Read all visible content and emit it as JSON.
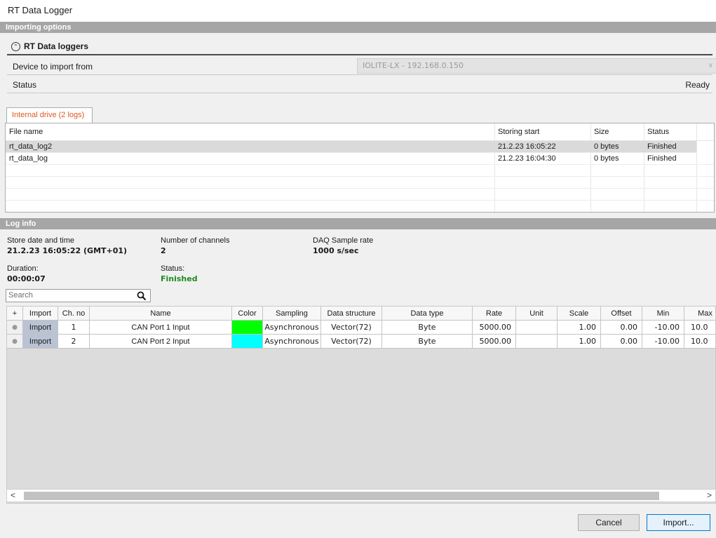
{
  "window": {
    "title": "RT Data Logger"
  },
  "importing_options": {
    "section_title": "Importing options",
    "group_title": "RT Data loggers",
    "device_label": "Device to import from",
    "device_value": "IOLITE-LX - 192.168.0.150",
    "status_label": "Status",
    "status_value": "Ready"
  },
  "tab": {
    "label": "Internal drive (2 logs)"
  },
  "files_table": {
    "columns": [
      "File name",
      "Storing start",
      "Size",
      "Status"
    ],
    "rows": [
      {
        "name": "rt_data_log2",
        "start": "21.2.23 16:05:22",
        "size": "0 bytes",
        "status": "Finished",
        "selected": true
      },
      {
        "name": "rt_data_log",
        "start": "21.2.23 16:04:30",
        "size": "0 bytes",
        "status": "Finished",
        "selected": false
      }
    ]
  },
  "log_info": {
    "section_title": "Log info",
    "store_date_label": "Store date and time",
    "store_date_value": "21.2.23 16:05:22 (GMT+01)",
    "channels_label": "Number of channels",
    "channels_value": "2",
    "sample_rate_label": "DAQ Sample rate",
    "sample_rate_value": "1000 s/sec",
    "duration_label": "Duration:",
    "duration_value": "00:00:07",
    "status_label": "Status:",
    "status_value": "Finished",
    "status_color": "#1e8a1e"
  },
  "search": {
    "placeholder": "Search",
    "icon": "search-icon"
  },
  "channels_grid": {
    "columns": [
      "+",
      "Import",
      "Ch. no",
      "Name",
      "Color",
      "Sampling",
      "Data structure",
      "Data type",
      "Rate",
      "Unit",
      "Scale",
      "Offset",
      "Min",
      "Max"
    ],
    "rows": [
      {
        "dot": "●",
        "import": "Import",
        "ch": "1",
        "name": "CAN Port 1 Input",
        "color": "#00ff00",
        "sampling": "Asynchronous",
        "structure": "Vector(72)",
        "type": "Byte",
        "rate": "5000.00",
        "unit": "",
        "scale": "1.00",
        "offset": "0.00",
        "min": "-10.00",
        "max": "10.0"
      },
      {
        "dot": "●",
        "import": "Import",
        "ch": "2",
        "name": "CAN Port 2 Input",
        "color": "#00ffff",
        "sampling": "Asynchronous",
        "structure": "Vector(72)",
        "type": "Byte",
        "rate": "5000.00",
        "unit": "",
        "scale": "1.00",
        "offset": "0.00",
        "min": "-10.00",
        "max": "10.0"
      }
    ]
  },
  "scrollbar": {
    "left_arrow": "<",
    "right_arrow": ">"
  },
  "buttons": {
    "cancel": "Cancel",
    "import": "Import..."
  }
}
